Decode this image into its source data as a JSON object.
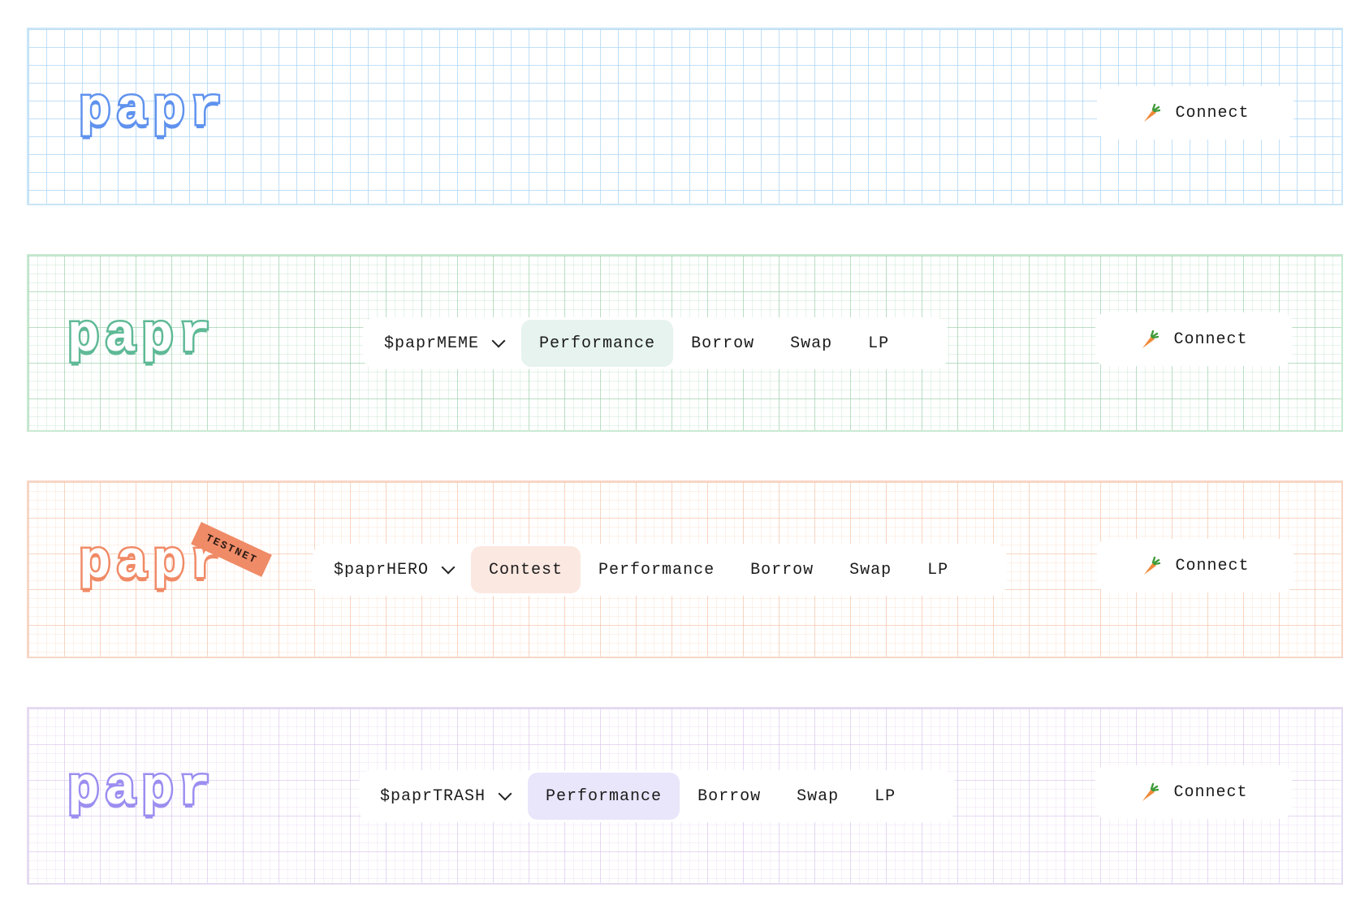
{
  "banners": [
    {
      "logo": "papr",
      "connect_label": "Connect",
      "accent": "#5f92ee"
    },
    {
      "logo": "papr",
      "connect_label": "Connect",
      "accent": "#5fb996",
      "nav": {
        "token": "$paprMEME",
        "items": [
          "Performance",
          "Borrow",
          "Swap",
          "LP"
        ],
        "active": "Performance"
      }
    },
    {
      "logo": "papr",
      "badge": "TESTNET",
      "connect_label": "Connect",
      "accent": "#f08a66",
      "nav": {
        "token": "$paprHERO",
        "items": [
          "Contest",
          "Performance",
          "Borrow",
          "Swap",
          "LP"
        ],
        "active": "Contest"
      }
    },
    {
      "logo": "papr",
      "connect_label": "Connect",
      "accent": "#9b8ef0",
      "nav": {
        "token": "$paprTRASH",
        "items": [
          "Performance",
          "Borrow",
          "Swap",
          "LP"
        ],
        "active": "Performance"
      }
    }
  ],
  "icons": {
    "connect": "carrot-icon",
    "token_dropdown": "chevron-down-icon"
  }
}
